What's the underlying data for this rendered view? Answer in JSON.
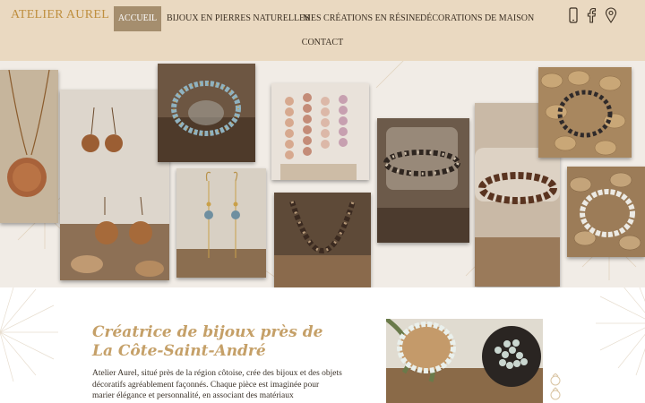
{
  "brand": {
    "name": "ATELIER AUREL"
  },
  "nav": {
    "items": [
      {
        "label": "ACCUEIL",
        "active": true
      },
      {
        "label": "BIJOUX EN PIERRES NATURELLES",
        "active": false
      },
      {
        "label": "MES CRÉATIONS EN RÉSINE",
        "active": false
      },
      {
        "label": "DÉCORATIONS DE MAISON",
        "active": false
      },
      {
        "label": "CONTACT",
        "active": false
      }
    ]
  },
  "header_icons": [
    "phone-icon",
    "facebook-icon",
    "location-pin-icon"
  ],
  "gallery": {
    "photos": [
      "resin-pendant-necklace-photo",
      "wooden-earrings-photo",
      "blue-bead-bracelet-photo",
      "blue-bead-earrings-photo",
      "pink-stone-bracelets-photo",
      "stone-bead-necklace-photo",
      "jar-bracelet-photo",
      "brown-bead-bracelet-photo",
      "cork-bracelet-photo",
      "white-bead-bracelet-photo"
    ]
  },
  "intro": {
    "heading": "Créatrice de bijoux près de La Côte-Saint-André",
    "text": "Atelier Aurel, situé près de la région côtoise, crée des bijoux et des objets décoratifs agréablement façonnés. Chaque pièce est imaginée pour marier élégance et personnalité, en associant des matériaux"
  },
  "colors": {
    "header_bg": "#ead9c1",
    "brand": "#bf8f3f",
    "nav_active_bg": "#a58e6e",
    "heading": "#c5a068",
    "text": "#3a3128"
  }
}
